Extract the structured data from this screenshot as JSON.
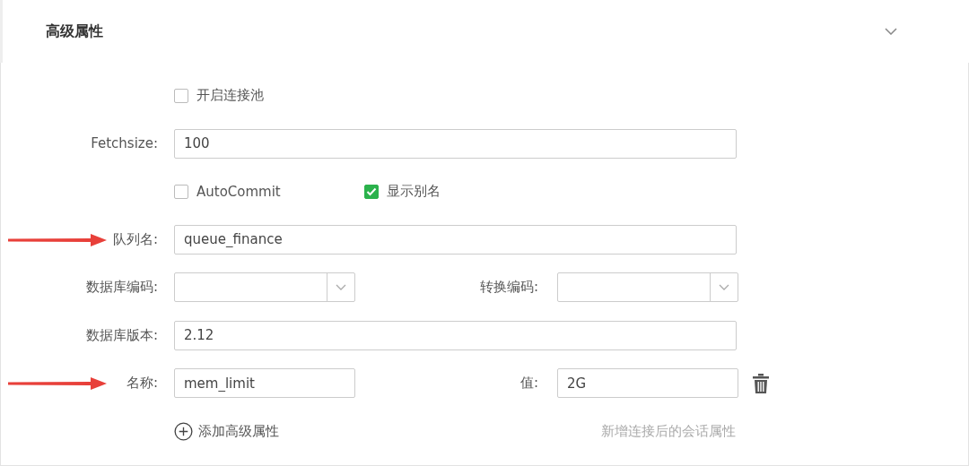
{
  "section": {
    "title": "高级属性",
    "expanded": true
  },
  "rows": [
    {
      "kind": "checks",
      "items": [
        {
          "label": "开启连接池",
          "checked": false
        }
      ]
    },
    {
      "kind": "input",
      "label": "Fetchsize:",
      "value": "100",
      "arrow": false
    },
    {
      "kind": "checks",
      "items": [
        {
          "label": "AutoCommit",
          "checked": false
        },
        {
          "label": "显示别名",
          "checked": true
        }
      ]
    },
    {
      "kind": "input",
      "label": "队列名:",
      "value": "queue_finance",
      "arrow": true
    },
    {
      "kind": "selects",
      "label": "数据库编码:",
      "label2": "转换编码:"
    },
    {
      "kind": "input",
      "label": "数据库版本:",
      "value": "2.12",
      "arrow": false
    },
    {
      "kind": "pair",
      "label": "名称:",
      "value": "mem_limit",
      "label2": "值:",
      "value2": "2G",
      "arrow": true
    },
    {
      "kind": "add",
      "button": "添加高级属性",
      "hint": "新增连接后的会话属性"
    }
  ]
}
